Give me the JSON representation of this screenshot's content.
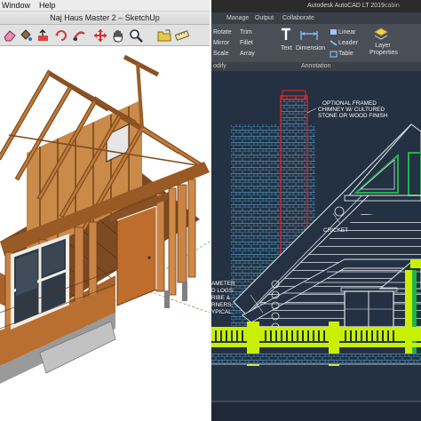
{
  "sketchup": {
    "menu": {
      "window": "Window",
      "help": "Help"
    },
    "title": "Naj Haus Master 2 – SketchUp",
    "toolbar": [
      {
        "icon": "eraser-icon"
      },
      {
        "icon": "paint-bucket-icon"
      },
      {
        "icon": "push-pull-icon"
      },
      {
        "icon": "rotate-icon"
      },
      {
        "icon": "follow-me-icon"
      },
      {
        "icon": "move-icon"
      },
      {
        "icon": "pan-hand-icon"
      },
      {
        "icon": "zoom-icon"
      },
      {
        "icon": "folder-icon"
      },
      {
        "icon": "ruler-icon"
      }
    ],
    "accent": "#c0622a"
  },
  "autocad": {
    "title": "Autodesk AutoCAD LT 2019",
    "file": "cabin elevation",
    "tabs": [
      "Manage",
      "Output",
      "Collaborate"
    ],
    "modify": {
      "rotate": "Rotate",
      "trim": "Trim",
      "mirror": "Mirror",
      "fillet": "Fillet",
      "scale": "Scale",
      "array": "Array"
    },
    "annotation": {
      "text": "Text",
      "dimension": "Dimension",
      "linear": "Linear",
      "leader": "Leader",
      "table": "Table"
    },
    "layers": "Layer Properties",
    "panels": {
      "modify": "odify",
      "annotation": "Annotation"
    },
    "notes": {
      "chimney_1": "OPTIONAL FRAMED",
      "chimney_2": "CHIMNEY W/ CULTURED",
      "chimney_3": "STONE OR WOOD FINISH",
      "cricket": "CRICKET",
      "logs_1": "AMETER",
      "logs_2": "D LOGS",
      "logs_3": "RIBE &",
      "logs_4": "RNERS,",
      "logs_5": "YPICAL."
    },
    "colors": {
      "background": "#243142",
      "linework": "#dfe6ee",
      "stone": "#4a8fb3",
      "chimney": "#d9242a",
      "highlight": "#c8f000",
      "trim": "#1fb34a"
    }
  }
}
